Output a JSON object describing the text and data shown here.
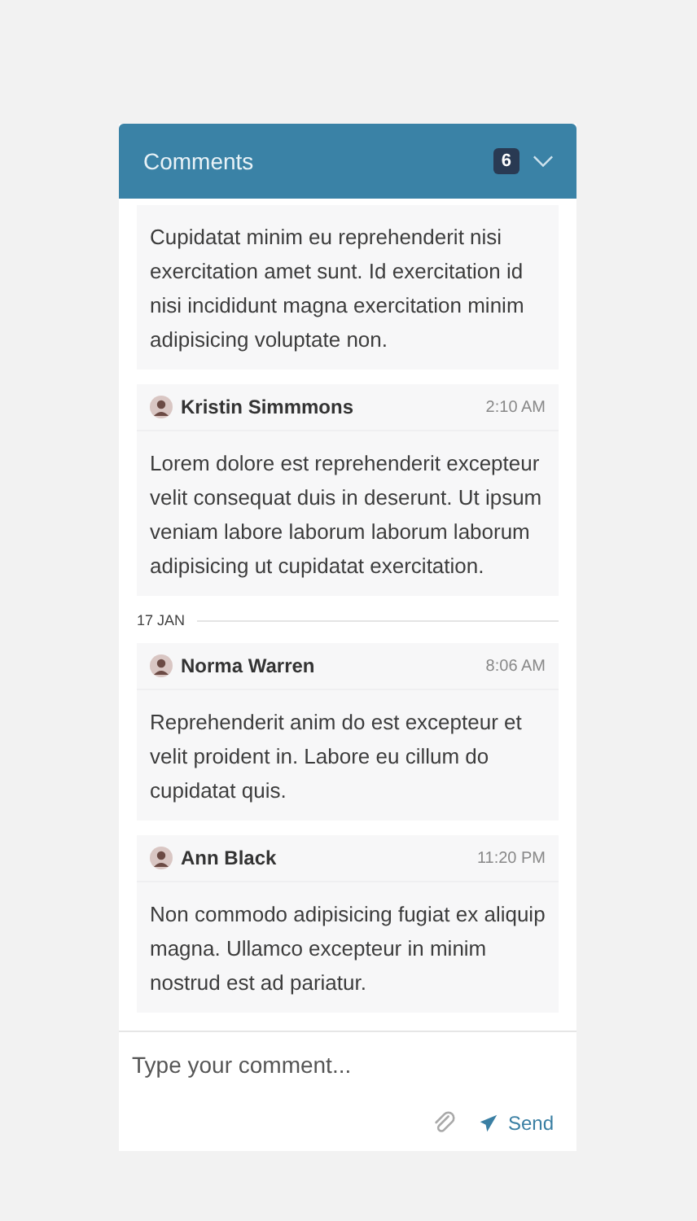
{
  "header": {
    "title": "Comments",
    "count": "6",
    "expanded": true
  },
  "feed": [
    {
      "kind": "comment",
      "body": "Cupidatat minim eu reprehenderit nisi exercitation amet sunt. Id exercitation id nisi incididunt magna exercitation minim adipisicing voluptate non."
    },
    {
      "kind": "comment",
      "author": "Kristin Simmmons",
      "time": "2:10 AM",
      "body": "Lorem dolore est reprehenderit excepteur velit consequat duis in deserunt. Ut ipsum veniam labore laborum laborum laborum adipisicing ut cupidatat exercitation."
    },
    {
      "kind": "date",
      "label": "17 JAN"
    },
    {
      "kind": "comment",
      "author": "Norma Warren",
      "time": "8:06 AM",
      "body": "Reprehenderit anim do est excepteur et velit proident in. Labore eu cillum do cupidatat quis."
    },
    {
      "kind": "comment",
      "author": "Ann Black",
      "time": "11:20 PM",
      "body": "Non commodo adipisicing fugiat ex aliquip magna. Ullamco excepteur in minim nostrud est ad pariatur."
    }
  ],
  "composer": {
    "placeholder": "Type your comment...",
    "send": "Send"
  }
}
